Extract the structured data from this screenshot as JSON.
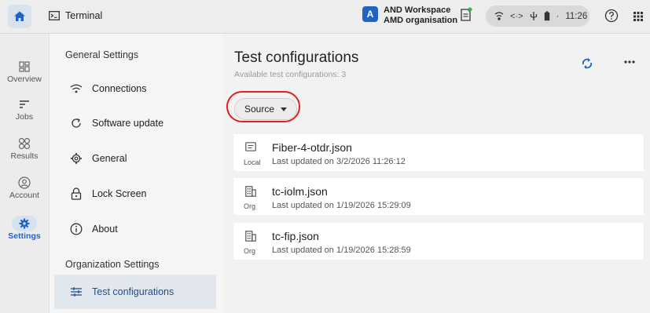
{
  "topbar": {
    "app_title": "Terminal",
    "workspace_initial": "A",
    "workspace_name": "AND Workspace",
    "organisation": "AMD organisation",
    "time": "11:26",
    "status_separator": "·"
  },
  "rail": {
    "items": [
      {
        "label": "Overview",
        "icon": "overview-icon"
      },
      {
        "label": "Jobs",
        "icon": "jobs-icon"
      },
      {
        "label": "Results",
        "icon": "results-icon"
      },
      {
        "label": "Account",
        "icon": "account-icon"
      },
      {
        "label": "Settings",
        "icon": "gear-icon",
        "active": true
      }
    ]
  },
  "settings_nav": {
    "general_title": "General Settings",
    "items": [
      {
        "label": "Connections",
        "icon": "wifi-icon"
      },
      {
        "label": "Software update",
        "icon": "update-icon"
      },
      {
        "label": "General",
        "icon": "gear-icon"
      },
      {
        "label": "Lock Screen",
        "icon": "lock-icon"
      },
      {
        "label": "About",
        "icon": "info-icon"
      }
    ],
    "org_title": "Organization Settings",
    "org_items": [
      {
        "label": "Test configurations",
        "icon": "sliders-icon",
        "active": true
      }
    ]
  },
  "main": {
    "title": "Test configurations",
    "subtitle": "Available test configurations: 3",
    "source_label": "Source",
    "configs": [
      {
        "name": "Fiber-4-otdr.json",
        "source": "Local",
        "updated": "Last updated on 3/2/2026 11:26:12",
        "icon": "document-icon"
      },
      {
        "name": "tc-iolm.json",
        "source": "Org",
        "updated": "Last updated on 1/19/2026 15:29:09",
        "icon": "building-icon"
      },
      {
        "name": "tc-fip.json",
        "source": "Org",
        "updated": "Last updated on 1/19/2026 15:28:59",
        "icon": "building-icon"
      }
    ]
  },
  "colors": {
    "accent": "#1f64c4",
    "highlight": "#e02020"
  }
}
